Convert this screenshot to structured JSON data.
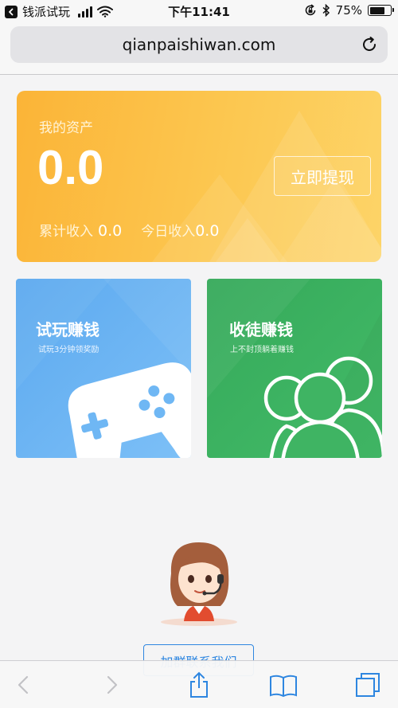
{
  "status_bar": {
    "app_name": "钱派试玩",
    "time": "下午11:41",
    "battery": "75%",
    "battery_level": 0.75
  },
  "browser": {
    "url": "qianpaishiwan.com"
  },
  "assets": {
    "label": "我的资产",
    "value": "0.0",
    "withdraw_label": "立即提现",
    "total_income_label": "累计收入",
    "total_income_value": "0.0",
    "today_income_label": "今日收入",
    "today_income_value": "0.0"
  },
  "cards": [
    {
      "title": "试玩赚钱",
      "subtitle": "试玩3分钟领奖励",
      "icon": "gamepad-icon",
      "color": "#5ca9ef"
    },
    {
      "title": "收徒赚钱",
      "subtitle": "上不封顶躺着赚钱",
      "icon": "people-icon",
      "color": "#35a95a"
    }
  ],
  "support": {
    "join_label": "加群联系我们",
    "icon": "customer-service-avatar"
  },
  "colors": {
    "asset_gradient_start": "#fbb437",
    "asset_gradient_end": "#fdd468",
    "link_blue": "#2e86e0"
  },
  "toolbar": {
    "icons": [
      "chevron-left-icon",
      "chevron-right-icon",
      "share-icon",
      "bookmarks-icon",
      "tabs-icon"
    ]
  }
}
